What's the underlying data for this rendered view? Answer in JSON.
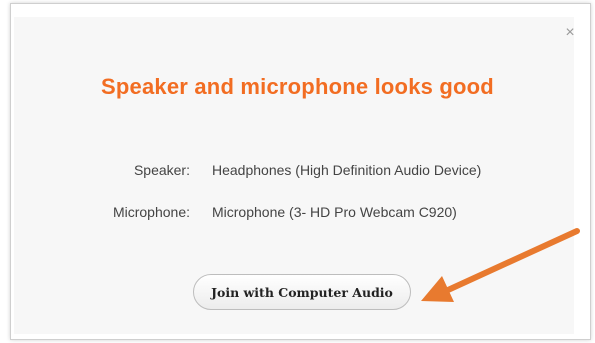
{
  "dialog": {
    "title": "Speaker and microphone looks good",
    "close_glyph": "×",
    "speaker": {
      "label": "Speaker:",
      "value": "Headphones (High Definition Audio Device)"
    },
    "microphone": {
      "label": "Microphone:",
      "value": "Microphone (3- HD Pro Webcam C920)"
    },
    "join_button_label": "Join with Computer Audio"
  },
  "colors": {
    "title": "#f26d22",
    "annotation_arrow": "#e87a2f",
    "dialog_background": "#f7f7f7"
  },
  "icons": {
    "close": "close-icon",
    "annotation": "arrow-annotation-icon"
  }
}
